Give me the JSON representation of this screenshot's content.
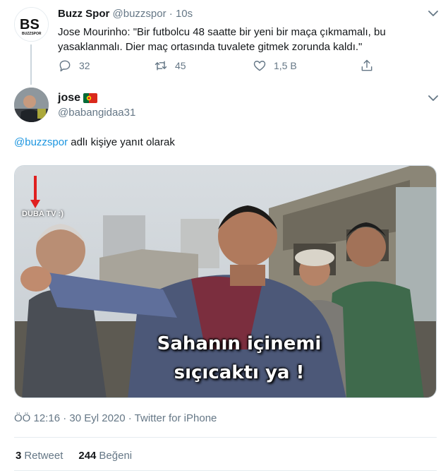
{
  "original_tweet": {
    "avatar_text": "BS",
    "avatar_subtext": "BUZZSPOR",
    "name": "Buzz Spor",
    "handle": "@buzzspor",
    "separator": "·",
    "time": "10s",
    "text": "Jose Mourinho: \"Bir futbolcu 48 saatte bir yeni bir maça çıkmamalı, bu yasaklanmalı. Dier maç ortasında tuvalete gitmek zorunda kaldı.\"",
    "replies": "32",
    "retweets": "45",
    "likes": "1,5 B",
    "icons": {
      "more": "chevron-down-icon",
      "reply": "reply-icon",
      "retweet": "retweet-icon",
      "like": "heart-icon",
      "share": "share-icon"
    }
  },
  "reply_tweet": {
    "name": "jose",
    "handle": "@babangidaa31",
    "reply_prefix": "@buzzspor",
    "reply_suffix": " adlı kişiye yanıt olarak",
    "media": {
      "watermark": "DUBA TV :)",
      "caption_line1": "Sahanın içinemi",
      "caption_line2": "sıçıcaktı ya !"
    },
    "meta_time": "ÖÖ 12:16 · 30 Eyl 2020 · ",
    "meta_source": "Twitter for iPhone",
    "retweet_count": "3",
    "retweet_label": "Retweet",
    "like_count": "244",
    "like_label": "Beğeni"
  },
  "colors": {
    "accent": "#1b95e0",
    "secondary_text": "#657786",
    "border": "#e6ecf0"
  }
}
